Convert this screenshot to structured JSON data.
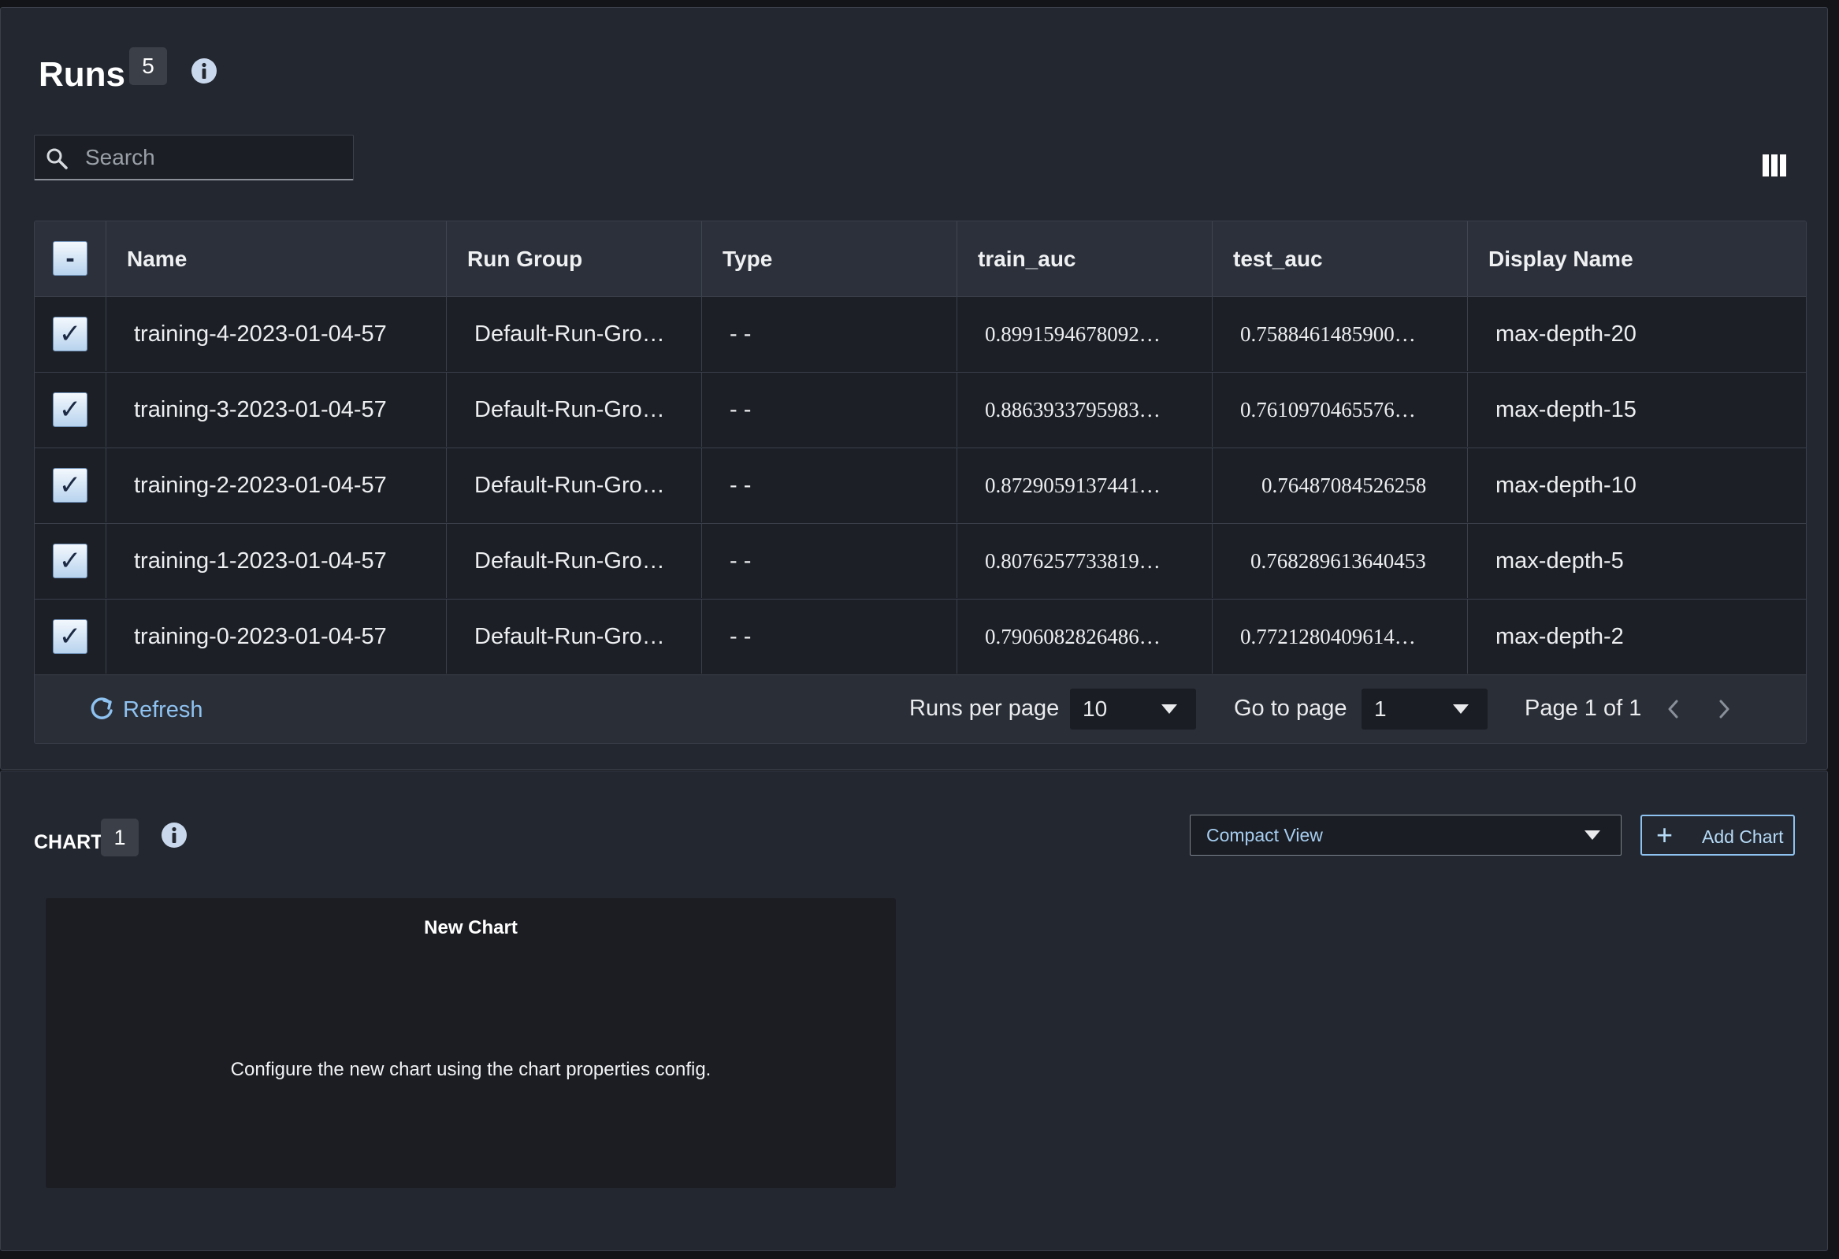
{
  "runs": {
    "title": "Runs",
    "count": "5",
    "search_placeholder": "Search",
    "columns": [
      "Name",
      "Run Group",
      "Type",
      "train_auc",
      "test_auc",
      "Display Name"
    ],
    "header_checkbox": "-",
    "rows": [
      {
        "name": "training-4-2023-01-04-57",
        "run_group": "Default-Run-Gro…",
        "type": "- -",
        "train_auc": "0.8991594678092…",
        "test_auc": "0.7588461485900…",
        "display_name": "max-depth-20"
      },
      {
        "name": "training-3-2023-01-04-57",
        "run_group": "Default-Run-Gro…",
        "type": "- -",
        "train_auc": "0.8863933795983…",
        "test_auc": "0.7610970465576…",
        "display_name": "max-depth-15"
      },
      {
        "name": "training-2-2023-01-04-57",
        "run_group": "Default-Run-Gro…",
        "type": "- -",
        "train_auc": "0.8729059137441…",
        "test_auc": "0.76487084526258",
        "display_name": "max-depth-10"
      },
      {
        "name": "training-1-2023-01-04-57",
        "run_group": "Default-Run-Gro…",
        "type": "- -",
        "train_auc": "0.8076257733819…",
        "test_auc": "0.768289613640453",
        "display_name": "max-depth-5"
      },
      {
        "name": "training-0-2023-01-04-57",
        "run_group": "Default-Run-Gro…",
        "type": "- -",
        "train_auc": "0.7906082826486…",
        "test_auc": "0.7721280409614…",
        "display_name": "max-depth-2"
      }
    ],
    "footer": {
      "refresh": "Refresh",
      "runs_per_page_label": "Runs per page",
      "runs_per_page_value": "10",
      "go_to_page_label": "Go to page",
      "go_to_page_value": "1",
      "page_info": "Page 1 of 1"
    }
  },
  "chart": {
    "title": "CHART",
    "count": "1",
    "view_select": "Compact View",
    "add_chart": "Add Chart",
    "card_title": "New Chart",
    "card_message": "Configure the new chart using the chart properties config."
  },
  "icons": {
    "info": "info-icon",
    "search": "search-icon",
    "columns": "columns-icon",
    "refresh": "refresh-icon",
    "plus": "plus-icon",
    "chevron_left": "chevron-left-icon",
    "chevron_right": "chevron-right-icon",
    "caret_down": "caret-down-icon"
  },
  "colors": {
    "background": "#232730",
    "accent_link": "#8ec2f0",
    "checkbox": "#b8d3ee"
  }
}
